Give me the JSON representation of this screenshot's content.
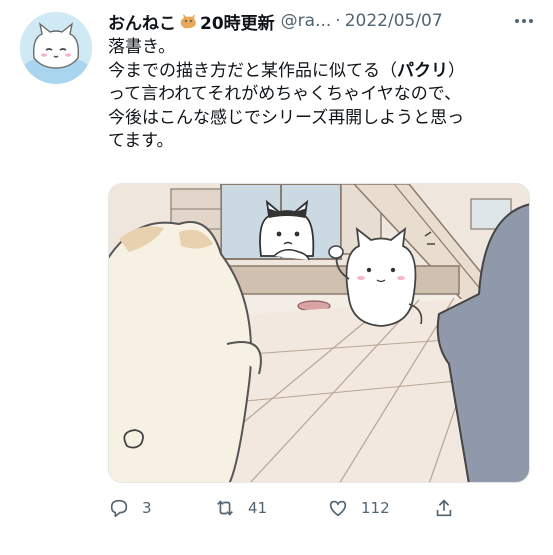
{
  "tweet": {
    "display_name": "おんねこ",
    "name_suffix": "20時更新",
    "handle": "@ra...",
    "separator": "·",
    "date": "2022/05/07",
    "text_lines": [
      "落書き。",
      "今までの描き方だと某作品に似てる（",
      "パクリ",
      "）",
      "って言われてそれがめちゃくちゃイヤなので、",
      "今後はこんな感じでシリーズ再開しようと思っ",
      "てます。"
    ]
  },
  "actions": {
    "reply_count": "3",
    "retweet_count": "41",
    "like_count": "112"
  },
  "icons": {
    "avatar": "cat-avatar",
    "name_emoji": "cat-emoji",
    "more": "more-icon",
    "reply": "reply-icon",
    "retweet": "retweet-icon",
    "like": "heart-icon",
    "share": "share-icon"
  }
}
